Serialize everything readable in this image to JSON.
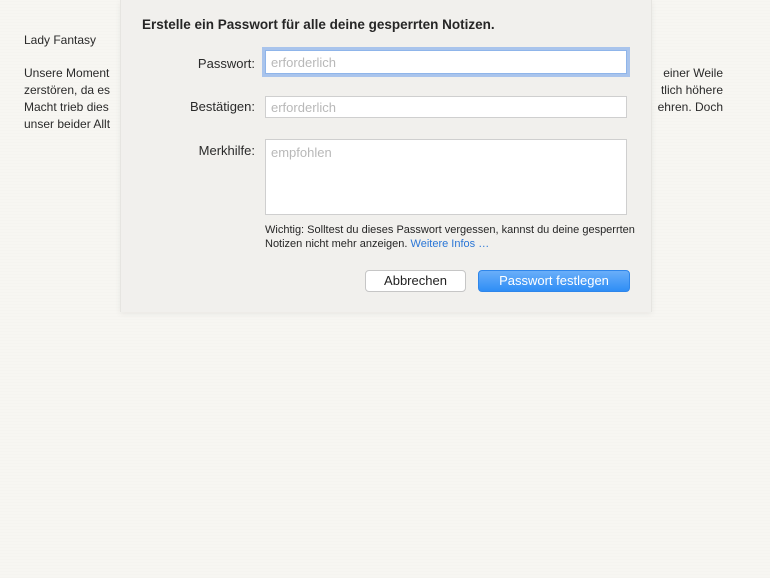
{
  "note": {
    "title": "Lady Fantasy",
    "left_lines": [
      "Unsere Moment",
      "zerstören, da es",
      "Macht trieb dies",
      "unser beider Allt"
    ],
    "right_lines": [
      "einer Weile",
      "tlich höhere",
      "ehren. Doch"
    ]
  },
  "dialog": {
    "title": "Erstelle ein Passwort für alle deine gesperrten Notizen.",
    "password": {
      "label": "Passwort:",
      "placeholder": "erforderlich",
      "value": ""
    },
    "confirm": {
      "label": "Bestätigen:",
      "placeholder": "erforderlich",
      "value": ""
    },
    "hint": {
      "label": "Merkhilfe:",
      "placeholder": "empfohlen",
      "value": ""
    },
    "warning_text": "Wichtig: Solltest du dieses Passwort vergessen, kannst du deine gesperrten Notizen nicht mehr anzeigen.",
    "more_info_link": "Weitere Infos …",
    "cancel_label": "Abbrechen",
    "confirm_label": "Passwort festlegen"
  },
  "colors": {
    "accent": "#2f8ef6",
    "link": "#2a76d6",
    "focus_ring": "#8fb5ea"
  }
}
